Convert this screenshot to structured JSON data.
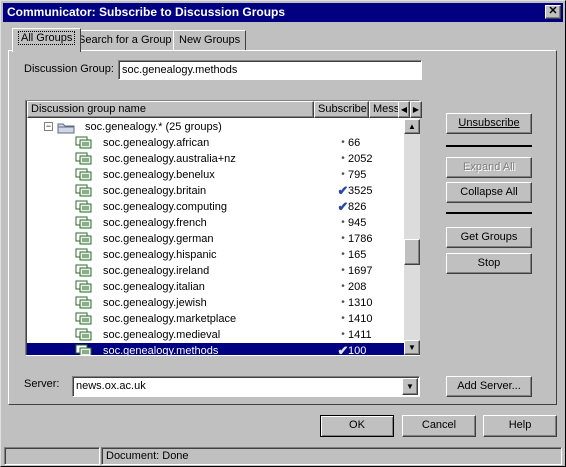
{
  "window": {
    "title": "Communicator: Subscribe to Discussion Groups",
    "close_glyph": "✕"
  },
  "tabs": [
    {
      "label": "All Groups",
      "active": true
    },
    {
      "label": "Search for a Group",
      "active": false
    },
    {
      "label": "New Groups",
      "active": false
    }
  ],
  "discussion_group": {
    "label": "Discussion Group:",
    "value": "soc.genealogy.methods"
  },
  "list": {
    "columns": [
      "Discussion group name",
      "Subscribe",
      "Messages"
    ],
    "parent": {
      "label": "soc.genealogy.* (25 groups)",
      "expander": "−"
    },
    "rows": [
      {
        "name": "soc.genealogy.african",
        "subscribed": false,
        "messages": "66"
      },
      {
        "name": "soc.genealogy.australia+nz",
        "subscribed": false,
        "messages": "2052"
      },
      {
        "name": "soc.genealogy.benelux",
        "subscribed": false,
        "messages": "795"
      },
      {
        "name": "soc.genealogy.britain",
        "subscribed": true,
        "messages": "3525"
      },
      {
        "name": "soc.genealogy.computing",
        "subscribed": true,
        "messages": "826"
      },
      {
        "name": "soc.genealogy.french",
        "subscribed": false,
        "messages": "945"
      },
      {
        "name": "soc.genealogy.german",
        "subscribed": false,
        "messages": "1786"
      },
      {
        "name": "soc.genealogy.hispanic",
        "subscribed": false,
        "messages": "165"
      },
      {
        "name": "soc.genealogy.ireland",
        "subscribed": false,
        "messages": "1697"
      },
      {
        "name": "soc.genealogy.italian",
        "subscribed": false,
        "messages": "208"
      },
      {
        "name": "soc.genealogy.jewish",
        "subscribed": false,
        "messages": "1310"
      },
      {
        "name": "soc.genealogy.marketplace",
        "subscribed": false,
        "messages": "1410"
      },
      {
        "name": "soc.genealogy.medieval",
        "subscribed": false,
        "messages": "1411"
      },
      {
        "name": "soc.genealogy.methods",
        "subscribed": true,
        "messages": "100",
        "selected": true
      }
    ],
    "glyphs": {
      "check": "✔",
      "dot": "•",
      "scroll_up": "▲",
      "scroll_down": "▼",
      "scroll_left": "◀",
      "scroll_right": "▶"
    }
  },
  "side_buttons": {
    "unsubscribe": "Unsubscribe",
    "expand_all": "Expand All",
    "collapse_all": "Collapse All",
    "get_groups": "Get Groups",
    "stop": "Stop"
  },
  "server": {
    "label": "Server:",
    "value": "news.ox.ac.uk",
    "add_label": "Add Server..."
  },
  "footer_buttons": {
    "ok": "OK",
    "cancel": "Cancel",
    "help": "Help"
  },
  "status": {
    "text": "Document: Done"
  },
  "colors": {
    "selection": "#000080",
    "check": "#2848a8",
    "face": "#c0c0c0"
  }
}
